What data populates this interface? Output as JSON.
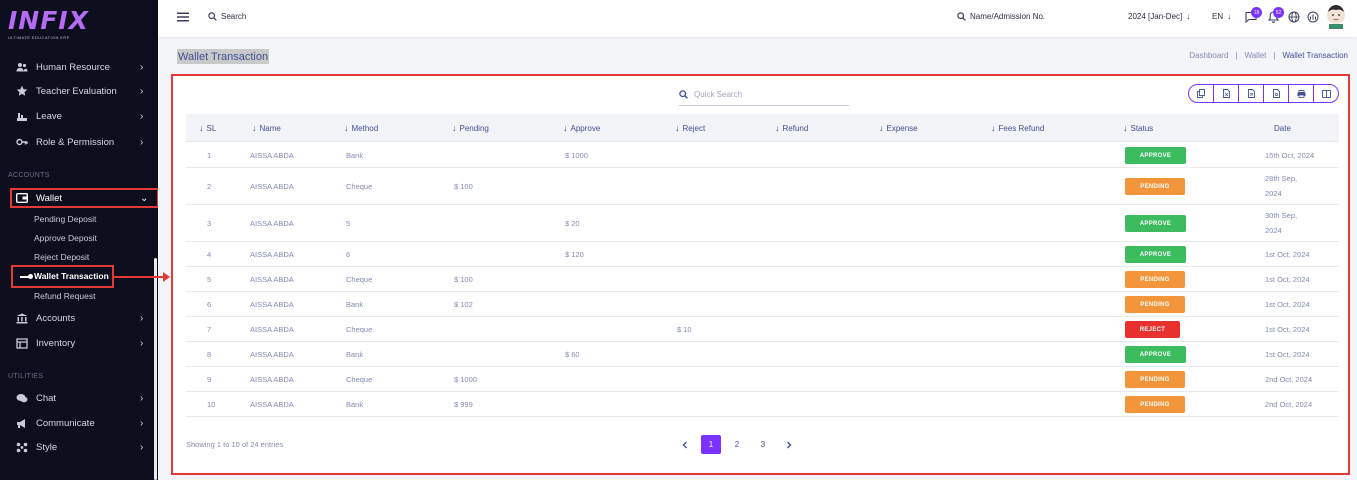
{
  "brand": {
    "logo_text": "INFIX",
    "tagline": "ULTIMATE EDUCATION ERP"
  },
  "sidebar": {
    "items_top": [
      {
        "label": "Human Resource",
        "icon": "users-icon"
      },
      {
        "label": "Teacher Evaluation",
        "icon": "star-icon"
      },
      {
        "label": "Leave",
        "icon": "leave-icon"
      },
      {
        "label": "Role & Permission",
        "icon": "key-icon"
      }
    ],
    "section_accounts": "ACCOUNTS",
    "wallet_label": "Wallet",
    "wallet_sub": [
      "Pending Deposit",
      "Approve Deposit",
      "Reject Deposit",
      "Wallet Transaction",
      "Refund Request"
    ],
    "items_accounts": [
      {
        "label": "Accounts",
        "icon": "bank-icon"
      },
      {
        "label": "Inventory",
        "icon": "inventory-icon"
      }
    ],
    "section_utilities": "UTILITIES",
    "items_utilities": [
      {
        "label": "Chat",
        "icon": "chat-icon"
      },
      {
        "label": "Communicate",
        "icon": "megaphone-icon"
      },
      {
        "label": "Style",
        "icon": "style-icon"
      }
    ]
  },
  "topbar": {
    "search_label": "Search",
    "student_search_label": "Name/Admission No.",
    "session": "2024 [Jan-Dec]",
    "language": "EN",
    "chat_badge": "18",
    "notification_badge": "52"
  },
  "page": {
    "title": "Wallet Transaction",
    "breadcrumb": [
      "Dashboard",
      "Wallet",
      "Wallet Transaction"
    ]
  },
  "table": {
    "quick_search_placeholder": "Quick Search",
    "headers": [
      "SL",
      "Name",
      "Method",
      "Pending",
      "Approve",
      "Reject",
      "Refund",
      "Expense",
      "Fees Refund",
      "Status",
      "Date"
    ],
    "rows": [
      {
        "sl": "1",
        "name": "AISSA ABDA",
        "method": "Bank",
        "pending": "",
        "approve": "$ 1000",
        "reject": "",
        "status": "APPROVE",
        "date_line1": "15th Oct, 2024",
        "date_line2": ""
      },
      {
        "sl": "2",
        "name": "AISSA ABDA",
        "method": "Cheque",
        "pending": "$ 100",
        "approve": "",
        "reject": "",
        "status": "PENDING",
        "date_line1": "28th Sep,",
        "date_line2": "2024"
      },
      {
        "sl": "3",
        "name": "AISSA ABDA",
        "method": "5",
        "pending": "",
        "approve": "$ 20",
        "reject": "",
        "status": "APPROVE",
        "date_line1": "30th Sep,",
        "date_line2": "2024"
      },
      {
        "sl": "4",
        "name": "AISSA ABDA",
        "method": "6",
        "pending": "",
        "approve": "$ 120",
        "reject": "",
        "status": "APPROVE",
        "date_line1": "1st Oct, 2024",
        "date_line2": ""
      },
      {
        "sl": "5",
        "name": "AISSA ABDA",
        "method": "Cheque",
        "pending": "$ 100",
        "approve": "",
        "reject": "",
        "status": "PENDING",
        "date_line1": "1st Oct, 2024",
        "date_line2": ""
      },
      {
        "sl": "6",
        "name": "AISSA ABDA",
        "method": "Bank",
        "pending": "$ 102",
        "approve": "",
        "reject": "",
        "status": "PENDING",
        "date_line1": "1st Oct, 2024",
        "date_line2": ""
      },
      {
        "sl": "7",
        "name": "AISSA ABDA",
        "method": "Cheque",
        "pending": "",
        "approve": "",
        "reject": "$ 10",
        "status": "REJECT",
        "date_line1": "1st Oct, 2024",
        "date_line2": ""
      },
      {
        "sl": "8",
        "name": "AISSA ABDA",
        "method": "Bank",
        "pending": "",
        "approve": "$ 60",
        "reject": "",
        "status": "APPROVE",
        "date_line1": "1st Oct, 2024",
        "date_line2": ""
      },
      {
        "sl": "9",
        "name": "AISSA ABDA",
        "method": "Cheque",
        "pending": "$ 1000",
        "approve": "",
        "reject": "",
        "status": "PENDING",
        "date_line1": "2nd Oct, 2024",
        "date_line2": ""
      },
      {
        "sl": "10",
        "name": "AISSA ABDA",
        "method": "Bank",
        "pending": "$ 999",
        "approve": "",
        "reject": "",
        "status": "PENDING",
        "date_line1": "2nd Oct, 2024",
        "date_line2": ""
      }
    ],
    "showing_text": "Showing 1 to 10 of 24 entries",
    "pages": [
      "1",
      "2",
      "3"
    ],
    "current_page": "1"
  },
  "colors": {
    "accent": "#7c32ff",
    "approve": "#3dbb5f",
    "pending": "#f3963b",
    "reject": "#e8312f",
    "highlight": "#e53935"
  }
}
